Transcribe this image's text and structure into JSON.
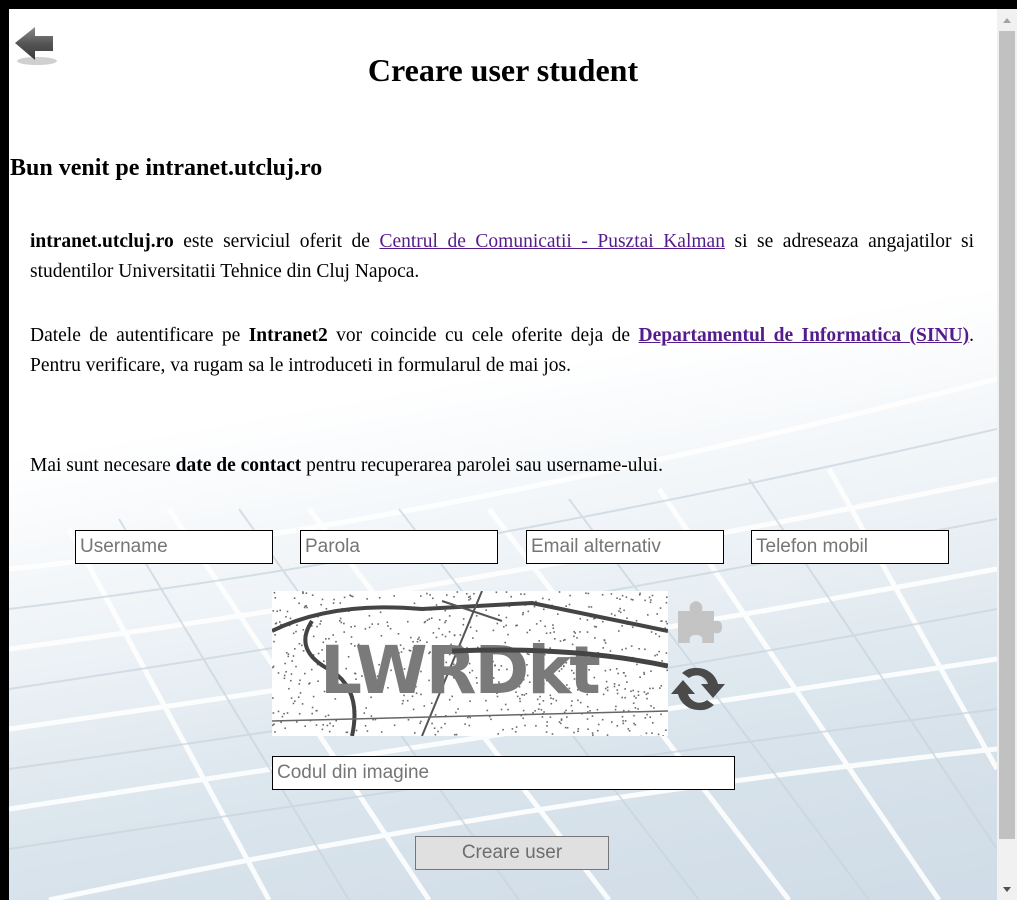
{
  "header": {
    "title": "Creare user student",
    "back_icon": "back-arrow-icon"
  },
  "welcome": "Bun venit pe intranet.utcluj.ro",
  "paragraph1": {
    "strong": "intranet.utcluj.ro",
    "text1": " este serviciul oferit de ",
    "link": "Centrul de Comunicatii - Pusztai Kalman",
    "text2": " si se adreseaza angajatilor si studentilor Universitatii Tehnice din Cluj Napoca."
  },
  "paragraph2": {
    "text1": "Datele de autentificare pe ",
    "strong": "Intranet2",
    "text2": " vor coincide cu cele oferite deja de ",
    "link": "Departamentul de Informatica (SINU)",
    "text3": ". Pentru verificare, va rugam sa le introduceti in formularul de mai jos."
  },
  "paragraph3": {
    "text1": "Mai sunt necesare ",
    "strong": "date de contact",
    "text2": " pentru recuperarea parolei sau username-ului."
  },
  "form": {
    "username_placeholder": "Username",
    "password_placeholder": "Parola",
    "email_placeholder": "Email alternativ",
    "phone_placeholder": "Telefon mobil",
    "captcha_text": "LWRDkt",
    "captcha_placeholder": "Codul din imagine",
    "submit_label": "Creare user"
  },
  "icons": {
    "puzzle": "puzzle-icon",
    "refresh": "refresh-icon"
  },
  "colors": {
    "link": "#551a8b",
    "frame": "#000000",
    "scrollbar_thumb": "#c1c1c1"
  }
}
